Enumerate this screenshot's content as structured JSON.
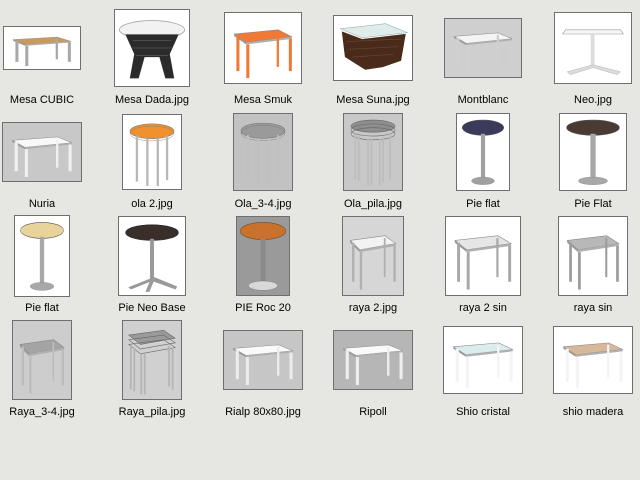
{
  "items": [
    {
      "label": "Mesa CUBIC",
      "style": "square",
      "top": "#c99a5a",
      "leg": "#a8a8a8",
      "bg": "#ffffff"
    },
    {
      "label": "Mesa Dada.jpg",
      "style": "wicker-round",
      "top": "#f2f2f2",
      "leg": "#2b2b2b",
      "bg": "#ffffff"
    },
    {
      "label": "Mesa Smuk",
      "style": "square",
      "top": "#f07a35",
      "leg": "#f07a35",
      "bg": "#ffffff"
    },
    {
      "label": "Mesa Suna.jpg",
      "style": "wicker-square",
      "top": "#e0ecec",
      "leg": "#4a2a1a",
      "bg": "#ffffff"
    },
    {
      "label": "Montblanc",
      "style": "square",
      "top": "#f4f4f4",
      "leg": "#d0d0d0",
      "bg": "#cfcfcf"
    },
    {
      "label": "Neo.jpg",
      "style": "cross-square",
      "top": "#f6f6f6",
      "leg": "#dcdcdc",
      "bg": "#ffffff"
    },
    {
      "label": "Nuria",
      "style": "square",
      "top": "#f8f8f8",
      "leg": "#f0f0f0",
      "bg": "#c8c8c8"
    },
    {
      "label": "ola 2.jpg",
      "style": "round",
      "top": "#f0902e",
      "leg": "#b8b8b8",
      "bg": "#ffffff"
    },
    {
      "label": "Ola_3-4.jpg",
      "style": "round",
      "top": "#9a9a9a",
      "leg": "#c0c0c0",
      "bg": "#c2c2c2"
    },
    {
      "label": "Ola_pila.jpg",
      "style": "stack-round",
      "top": "#8e8e8e",
      "leg": "#bcbcbc",
      "bg": "#c8c8c8"
    },
    {
      "label": "Pie flat",
      "style": "pedestal",
      "top": "#3a3a5a",
      "leg": "#a0a0a0",
      "bg": "#ffffff"
    },
    {
      "label": "Pie Flat",
      "style": "pedestal",
      "top": "#4a3a34",
      "leg": "#a8a8a8",
      "bg": "#ffffff"
    },
    {
      "label": "Pie flat",
      "style": "pedestal",
      "top": "#e8d49a",
      "leg": "#a8a8a8",
      "bg": "#ffffff"
    },
    {
      "label": "Pie Neo Base",
      "style": "cross-round",
      "top": "#3a2e2a",
      "leg": "#9a9a9a",
      "bg": "#ffffff"
    },
    {
      "label": "PIE Roc 20",
      "style": "pedestal-wide",
      "top": "#c8722e",
      "leg": "#8a8a8a",
      "bg": "#9a9a9a"
    },
    {
      "label": "raya 2.jpg",
      "style": "square",
      "top": "#f2f2f2",
      "leg": "#b0b0b0",
      "bg": "#d6d6d6"
    },
    {
      "label": "raya 2 sin",
      "style": "square",
      "top": "#e6e6e6",
      "leg": "#a8a8a8",
      "bg": "#ffffff"
    },
    {
      "label": "raya sin",
      "style": "square",
      "top": "#b8b8b8",
      "leg": "#9c9c9c",
      "bg": "#ffffff"
    },
    {
      "label": "Raya_3-4.jpg",
      "style": "square",
      "top": "#a4a4a4",
      "leg": "#bcbcbc",
      "bg": "#cdcdcd"
    },
    {
      "label": "Raya_pila.jpg",
      "style": "stack-square",
      "top": "#9a9a9a",
      "leg": "#b4b4b4",
      "bg": "#d0d0d0"
    },
    {
      "label": "Rialp 80x80.jpg",
      "style": "square",
      "top": "#fafafa",
      "leg": "#ececec",
      "bg": "#c6c6c6"
    },
    {
      "label": "Ripoll",
      "style": "square",
      "top": "#fafafa",
      "leg": "#eeeeee",
      "bg": "#b6b6b6"
    },
    {
      "label": "Shio cristal",
      "style": "square",
      "top": "#dcebeb",
      "leg": "#f4f4f4",
      "bg": "#ffffff"
    },
    {
      "label": "shio madera",
      "style": "square",
      "top": "#d8b89a",
      "leg": "#f4f4f4",
      "bg": "#ffffff"
    }
  ]
}
